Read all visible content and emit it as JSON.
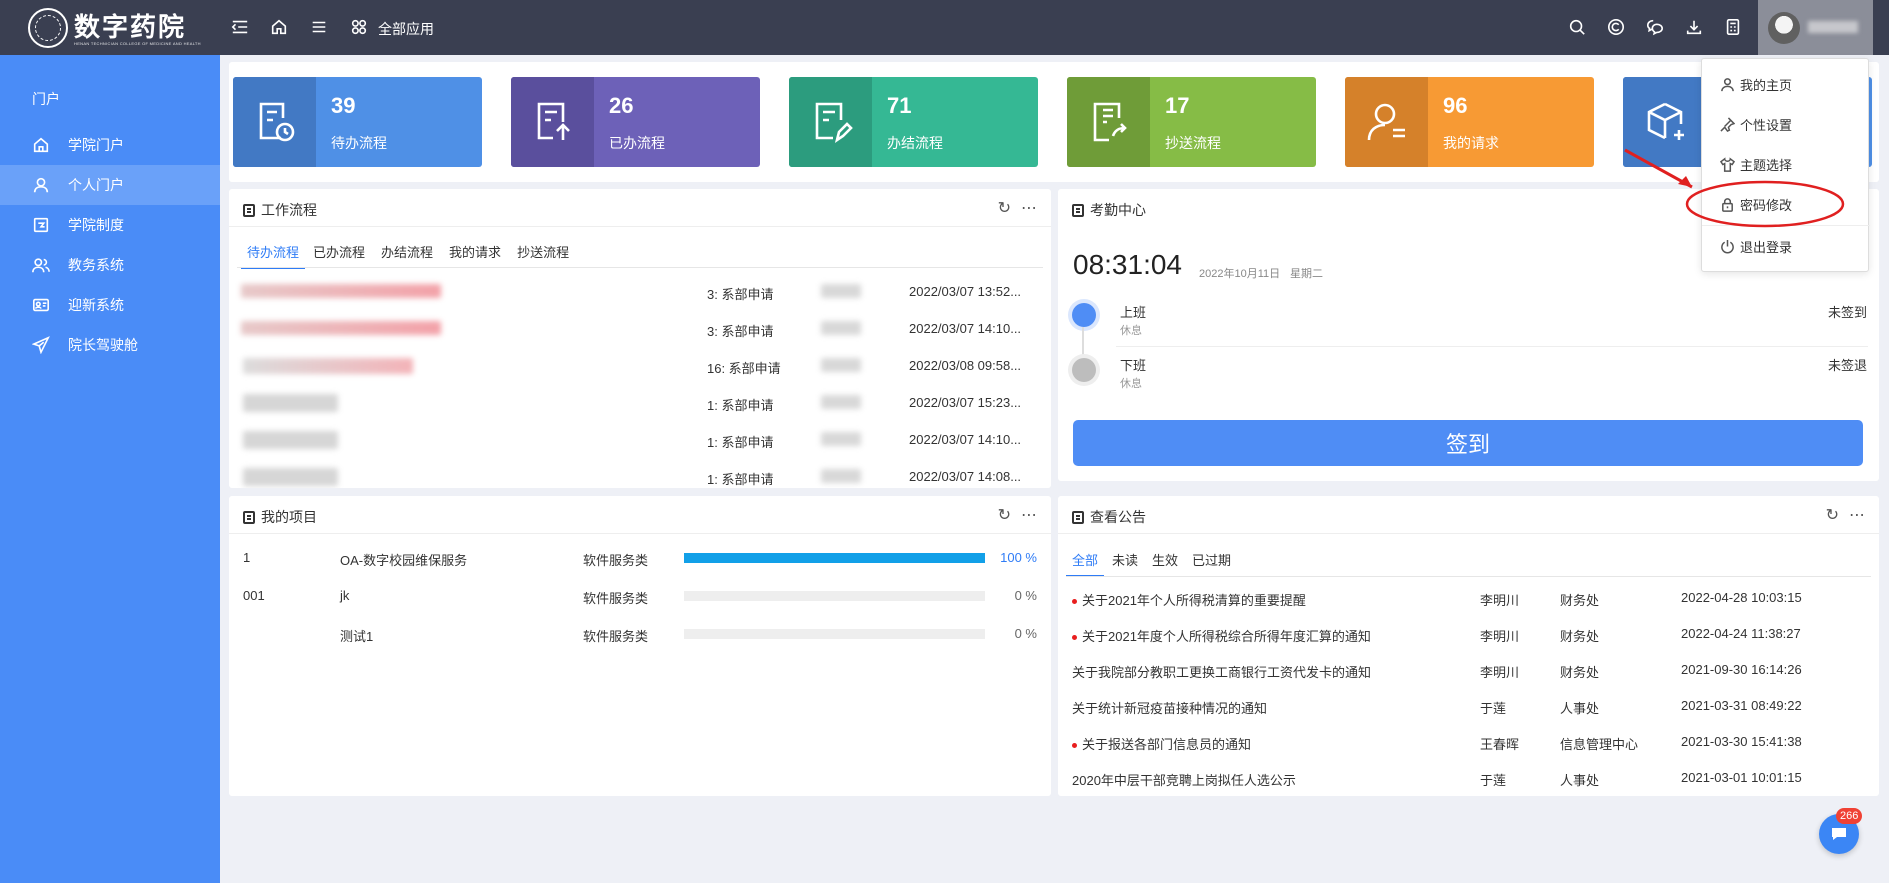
{
  "topbar": {
    "logo_text": "数字药院",
    "logo_sub": "HENAN TECHNICIAN COLLEGE OF MEDICINE AND HEALTH",
    "all_apps": "全部应用"
  },
  "sidebar": {
    "title": "门户",
    "items": [
      {
        "label": "学院门户",
        "icon": "home-icon"
      },
      {
        "label": "个人门户",
        "icon": "user-icon"
      },
      {
        "label": "学院制度",
        "icon": "policy-icon"
      },
      {
        "label": "教务系统",
        "icon": "users-icon"
      },
      {
        "label": "迎新系统",
        "icon": "id-card-icon"
      },
      {
        "label": "院长驾驶舱",
        "icon": "send-icon"
      }
    ]
  },
  "stats": [
    {
      "count": "39",
      "label": "待办流程",
      "color": "#4f90e6",
      "icon_bg": "#4279c4"
    },
    {
      "count": "26",
      "label": "已办流程",
      "color": "#6d61b8",
      "icon_bg": "#5a4f9d"
    },
    {
      "count": "71",
      "label": "办结流程",
      "color": "#35b894",
      "icon_bg": "#2c9c7e"
    },
    {
      "count": "17",
      "label": "抄送流程",
      "color": "#86bc46",
      "icon_bg": "#6f9c38"
    },
    {
      "count": "96",
      "label": "我的请求",
      "color": "#f79a34",
      "icon_bg": "#d5812a"
    },
    {
      "count": "",
      "label": "",
      "color": "#4f90e6",
      "icon_bg": "#4279c4"
    }
  ],
  "workflow": {
    "title": "工作流程",
    "tabs": [
      "待办流程",
      "已办流程",
      "办结流程",
      "我的请求",
      "抄送流程"
    ],
    "rows": [
      {
        "step": "3: 系部申请",
        "time": "2022/03/07 13:52..."
      },
      {
        "step": "3: 系部申请",
        "time": "2022/03/07 14:10..."
      },
      {
        "step": "16: 系部申请",
        "time": "2022/03/08 09:58..."
      },
      {
        "step": "1: 系部申请",
        "time": "2022/03/07 15:23..."
      },
      {
        "step": "1: 系部申请",
        "time": "2022/03/07 14:10..."
      },
      {
        "step": "1: 系部申请",
        "time": "2022/03/07 14:08..."
      }
    ]
  },
  "attendance": {
    "title": "考勤中心",
    "time": "08:31:04",
    "date": "2022年10月11日",
    "weekday": "星期二",
    "records": [
      {
        "label": "上班",
        "sub": "休息",
        "status": "未签到"
      },
      {
        "label": "下班",
        "sub": "休息",
        "status": "未签退"
      }
    ],
    "signin": "签到"
  },
  "projects": {
    "title": "我的项目",
    "rows": [
      {
        "id": "1",
        "name": "OA-数字校园维保服务",
        "type": "软件服务类",
        "percent": "100 %",
        "progress": 1.0
      },
      {
        "id": "001",
        "name": "jk",
        "type": "软件服务类",
        "percent": "0 %",
        "progress": 0
      },
      {
        "id": "",
        "name": "测试1",
        "type": "软件服务类",
        "percent": "0 %",
        "progress": 0
      }
    ]
  },
  "notices": {
    "title": "查看公告",
    "tabs": [
      "全部",
      "未读",
      "生效",
      "已过期"
    ],
    "rows": [
      {
        "title": "关于2021年个人所得税清算的重要提醒",
        "author": "李明川",
        "dept": "财务处",
        "time": "2022-04-28 10:03:15",
        "unread": true
      },
      {
        "title": "关于2021年度个人所得税综合所得年度汇算的通知",
        "author": "李明川",
        "dept": "财务处",
        "time": "2022-04-24 11:38:27",
        "unread": true
      },
      {
        "title": "关于我院部分教职工更换工商银行工资代发卡的通知",
        "author": "李明川",
        "dept": "财务处",
        "time": "2021-09-30 16:14:26",
        "unread": false
      },
      {
        "title": "关于统计新冠疫苗接种情况的通知",
        "author": "于莲",
        "dept": "人事处",
        "time": "2021-03-31 08:49:22",
        "unread": false
      },
      {
        "title": "关于报送各部门信息员的通知",
        "author": "王春晖",
        "dept": "信息管理中心",
        "time": "2021-03-30 15:41:38",
        "unread": true
      },
      {
        "title": "2020年中层干部竞聘上岗拟任人选公示",
        "author": "于莲",
        "dept": "人事处",
        "time": "2021-03-01 10:01:15",
        "unread": false
      }
    ]
  },
  "dropdown": {
    "items": [
      "我的主页",
      "个性设置",
      "主题选择",
      "密码修改",
      "退出登录"
    ]
  },
  "chat": {
    "badge": "266"
  },
  "colors": {
    "topbar": "#3a3f51",
    "sidebar": "#4a8cf7",
    "accent": "#2f7cf6",
    "annotation": "#e02020"
  }
}
